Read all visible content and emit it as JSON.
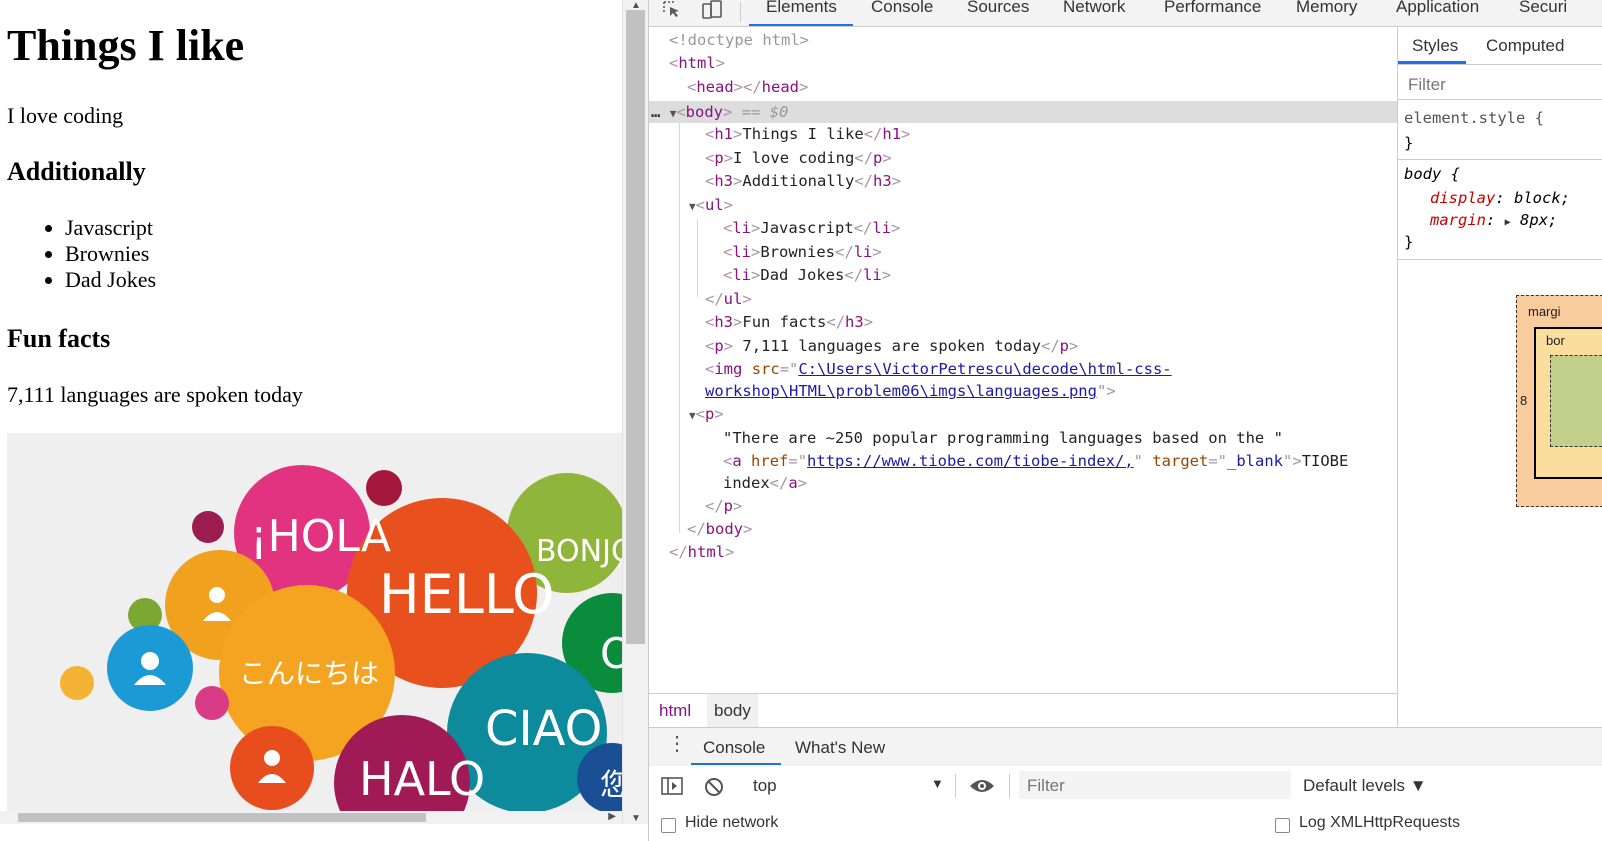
{
  "page": {
    "title": "Things I like",
    "intro": "I love coding",
    "section1": "Additionally",
    "items": [
      "Javascript",
      "Brownies",
      "Dad Jokes"
    ],
    "section2": "Fun facts",
    "fact": "7,111 languages are spoken today",
    "image_words": [
      "¡HOLA",
      "HELLO",
      "BONJOU",
      "こんにちは",
      "CIAO",
      "HALO",
      "O",
      "您"
    ]
  },
  "devtools": {
    "tabs": [
      "Elements",
      "Console",
      "Sources",
      "Network",
      "Performance",
      "Memory",
      "Application",
      "Securi"
    ],
    "active_tab": "Elements",
    "dom": {
      "doctype": "<!doctype html>",
      "html_open": "html",
      "head": "head",
      "body": "body",
      "selected_marker": "== $0",
      "h1_text": "Things I like",
      "p_text": "I love coding",
      "h3_text": "Additionally",
      "li": [
        "Javascript",
        "Brownies",
        "Dad Jokes"
      ],
      "h3b_text": "Fun facts",
      "p2_text": " 7,111 languages are spoken today",
      "img_src_part1": "C:\\Users\\VictorPetrescu\\decode\\html-css-",
      "img_src_part2": "workshop\\HTML\\problem06\\imgs\\languages.png",
      "p3_text": "\"There are ~250 popular programming languages based on the \"",
      "a_href": "https://www.tiobe.com/tiobe-index/,",
      "a_target": "_blank",
      "a_text1": "TIOBE",
      "a_text2": "index"
    },
    "breadcrumbs": [
      "html",
      "body"
    ],
    "styles": {
      "tabs": [
        "Styles",
        "Computed"
      ],
      "filter_placeholder": "Filter",
      "element_style": "element.style {",
      "close": "}",
      "body_rule": "body {",
      "display_prop": "display",
      "display_val": "block;",
      "margin_prop": "margin",
      "margin_val": "8px;",
      "box_margin_label": "margi",
      "box_border_label": "bor",
      "box_margin_value": "8"
    },
    "drawer": {
      "tabs": [
        "Console",
        "What's New"
      ],
      "context": "top",
      "filter_placeholder": "Filter",
      "levels": "Default levels ▼",
      "hide_network": "Hide network",
      "log_xhr": "Log XMLHttpRequests"
    }
  }
}
